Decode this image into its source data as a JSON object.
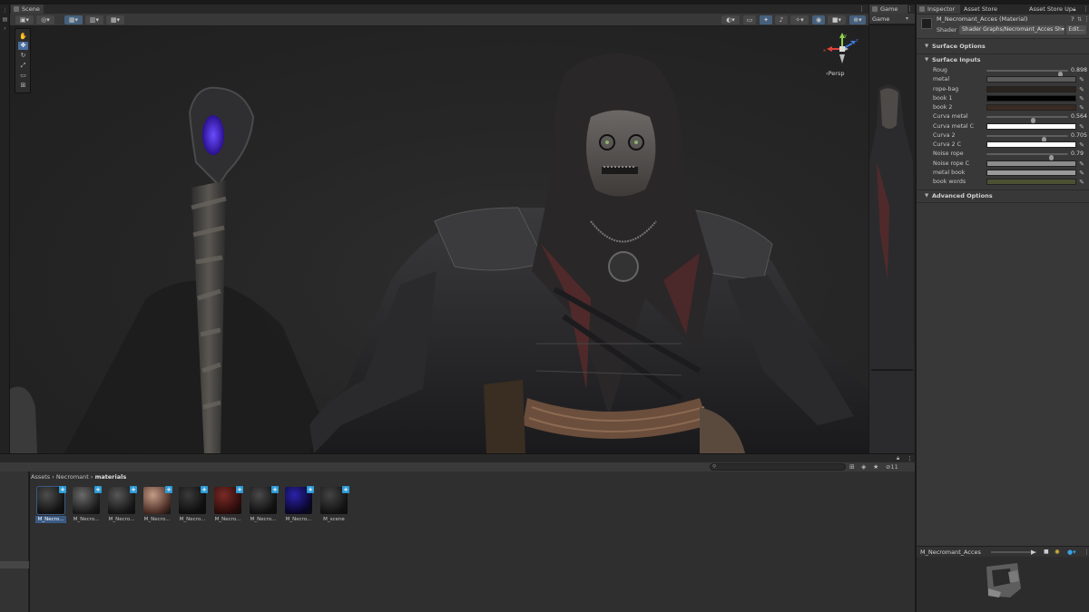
{
  "scene": {
    "tab_label": "Scene",
    "persp_label": "‹Persp",
    "gizmo_axes": {
      "x": "x",
      "y": "y",
      "z": "z"
    }
  },
  "game": {
    "tab_label": "Game",
    "display_label": "Game"
  },
  "inspector": {
    "tabs": [
      "Inspector",
      "Asset Store Validator",
      "Asset Store Up"
    ],
    "material_name": "M_Necromant_Acces (Material)",
    "shader_label": "Shader",
    "shader_value": "Shader Graphs/Necromant_Acces Sh▾",
    "edit_label": "Edit...",
    "sections": {
      "surface_options": "Surface Options",
      "surface_inputs": "Surface Inputs",
      "advanced_options": "Advanced Options"
    },
    "properties": [
      {
        "label": "Roug",
        "kind": "slider",
        "value": "0.898",
        "fraction": 0.898
      },
      {
        "label": "metal",
        "kind": "color",
        "color": "#5b5b5b"
      },
      {
        "label": "rope-bag",
        "kind": "color",
        "color": "#2a231d"
      },
      {
        "label": "book 1",
        "kind": "color",
        "color": "#020202"
      },
      {
        "label": "book 2",
        "kind": "color",
        "color": "#3a2b22"
      },
      {
        "label": "Curva metal",
        "kind": "slider",
        "value": "0.564",
        "fraction": 0.564
      },
      {
        "label": "Curva metal C",
        "kind": "color",
        "color": "#ffffff"
      },
      {
        "label": "Curva 2",
        "kind": "slider",
        "value": "0.705",
        "fraction": 0.705
      },
      {
        "label": "Curva 2 C",
        "kind": "color",
        "color": "#ffffff"
      },
      {
        "label": "Noise rope",
        "kind": "slider",
        "value": "0.79",
        "fraction": 0.79
      },
      {
        "label": "Noise rope C",
        "kind": "color",
        "color": "#8c8c8c"
      },
      {
        "label": "metal book",
        "kind": "color",
        "color": "#9a9a9a"
      },
      {
        "label": "book words",
        "kind": "color",
        "color": "#4c5134"
      }
    ],
    "preview_name": "M_Necromant_Acces"
  },
  "project": {
    "breadcrumb": [
      "Assets",
      "Necromant",
      "materials"
    ],
    "hidden_count": "11",
    "assets": [
      {
        "label": "M_Necro...",
        "top": "#4e4e4e",
        "base": "#121212"
      },
      {
        "label": "M_Necro...",
        "top": "#6a6a6a",
        "base": "#1a1a1a"
      },
      {
        "label": "M_Necro...",
        "top": "#575757",
        "base": "#161616"
      },
      {
        "label": "M_Necro...",
        "top": "#c49c86",
        "base": "#4a2c24"
      },
      {
        "label": "M_Necro...",
        "top": "#3a3a3a",
        "base": "#0e0e0e"
      },
      {
        "label": "M_Necro...",
        "top": "#7a2a26",
        "base": "#2a0c0b"
      },
      {
        "label": "M_Necro...",
        "top": "#4a4a4a",
        "base": "#101010"
      },
      {
        "label": "M_Necro...",
        "top": "#2a22aa",
        "base": "#090626"
      },
      {
        "label": "M_scene",
        "top": "#444444",
        "base": "#121212"
      }
    ]
  }
}
